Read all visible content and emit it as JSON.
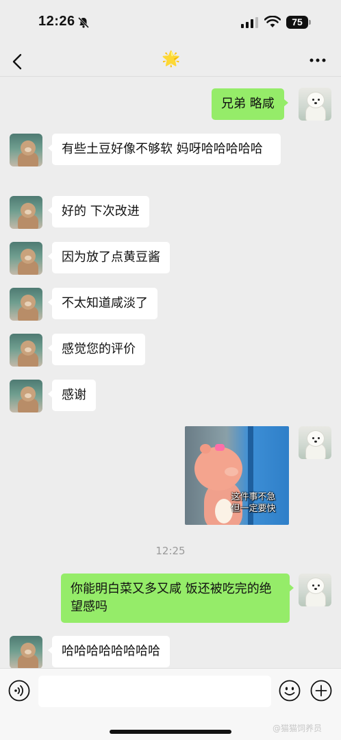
{
  "status_bar": {
    "time": "12:26",
    "battery": "75"
  },
  "nav": {
    "title_icon": "🌟"
  },
  "messages": [
    {
      "side": "out",
      "text": "兄弟 略咸"
    },
    {
      "side": "in",
      "text": "有些土豆好像不够软 妈呀哈哈哈哈哈"
    },
    {
      "side": "in",
      "text": "好的 下次改进"
    },
    {
      "side": "in",
      "text": "因为放了点黄豆酱"
    },
    {
      "side": "in",
      "text": "不太知道咸淡了"
    },
    {
      "side": "in",
      "text": "感觉您的评价"
    },
    {
      "side": "in",
      "text": "感谢"
    },
    {
      "side": "out",
      "type": "sticker",
      "caption_line1": "这件事不急",
      "caption_line2": "但一定要快"
    },
    {
      "type": "timestamp",
      "text": "12:25"
    },
    {
      "side": "out",
      "text": "你能明白菜又多又咸 饭还被吃完的绝望感吗"
    },
    {
      "side": "in",
      "text": "哈哈哈哈哈哈哈哈"
    }
  ],
  "input": {
    "placeholder": ""
  },
  "watermark": "@猫猫饲养员"
}
